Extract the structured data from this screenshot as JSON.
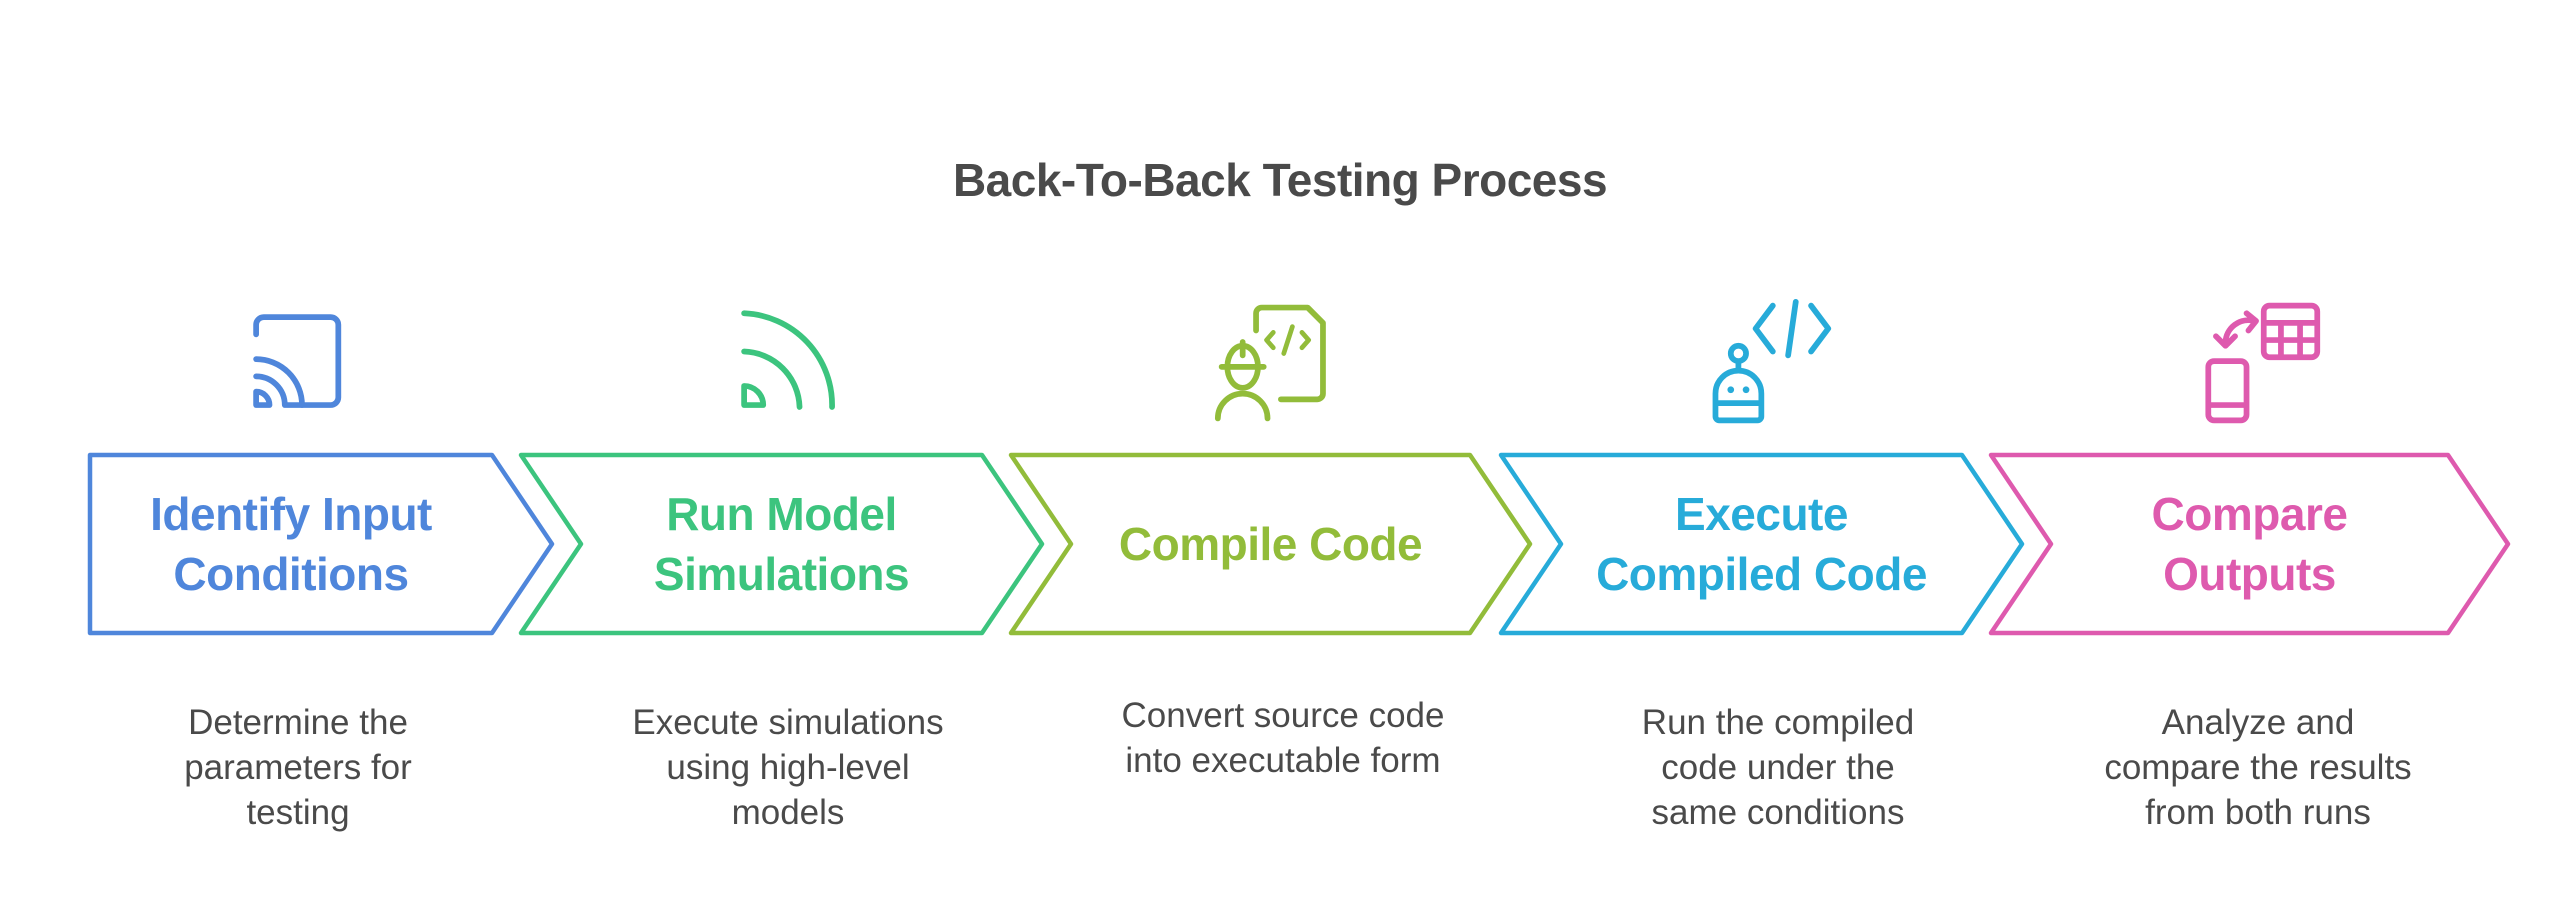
{
  "title": "Back-To-Back Testing Process",
  "steps": [
    {
      "label_lines": [
        "Identify Input",
        "Conditions"
      ],
      "description_lines": [
        "Determine the",
        "parameters for",
        "testing"
      ],
      "icon": "cast-icon",
      "color": "#4f86db"
    },
    {
      "label_lines": [
        "Run Model",
        "Simulations"
      ],
      "description_lines": [
        "Execute simulations",
        "using high-level",
        "models"
      ],
      "icon": "wireless-signal-icon",
      "color": "#3cc47e"
    },
    {
      "label_lines": [
        "Compile Code"
      ],
      "description_lines": [
        "Convert source code",
        "into executable form"
      ],
      "icon": "engineer-code-file-icon",
      "color": "#92bc3a"
    },
    {
      "label_lines": [
        "Execute",
        "Compiled Code"
      ],
      "description_lines": [
        "Run the compiled",
        "code under the",
        "same conditions"
      ],
      "icon": "robot-code-icon",
      "color": "#27abd9"
    },
    {
      "label_lines": [
        "Compare",
        "Outputs"
      ],
      "description_lines": [
        "Analyze and",
        "compare the results",
        "from both runs"
      ],
      "icon": "device-table-sync-icon",
      "color": "#de5aae"
    }
  ]
}
